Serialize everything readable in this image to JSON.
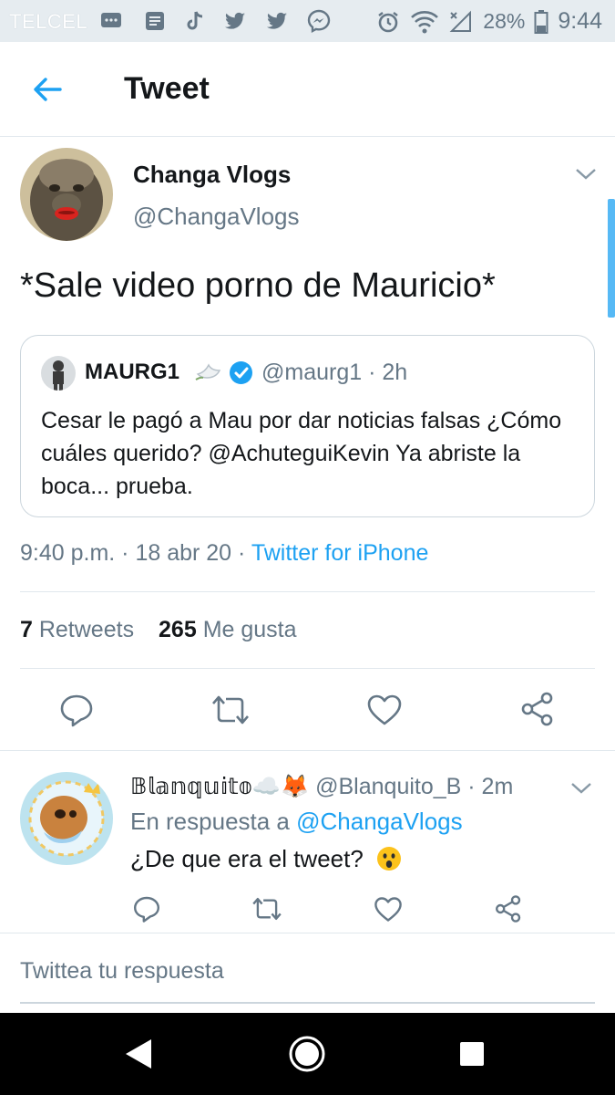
{
  "status_bar": {
    "carrier": "TELCEL",
    "battery_percent": "28%",
    "time": "9:44",
    "icons": [
      "message-icon",
      "news-icon",
      "tiktok-icon",
      "twitter-icon",
      "twitter-icon",
      "messenger-icon",
      "alarm-icon",
      "wifi-icon",
      "signal-icon",
      "battery-icon"
    ]
  },
  "header": {
    "title": "Tweet"
  },
  "tweet": {
    "author_name": "Changa Vlogs",
    "author_handle": "@ChangaVlogs",
    "text": "*Sale video porno de Mauricio*",
    "quoted": {
      "name": "MAURG1",
      "handle_time": "@maurg1 · 2h",
      "text": "Cesar le pagó a Mau por dar noticias falsas ¿Cómo cuáles querido? @AchuteguiKevin Ya abriste la boca... prueba."
    },
    "timestamp": "9:40 p.m. · 18 abr 20 · ",
    "source": "Twitter for iPhone",
    "retweets_count": "7",
    "retweets_label": " Retweets",
    "likes_count": "265",
    "likes_label": " Me gusta"
  },
  "reply": {
    "name": "𝔹𝕝𝕒𝕟𝕢𝕦𝕚𝕥𝕠",
    "name_emojis": "☁️🦊",
    "handle_time": "@Blanquito_B · 2m",
    "in_reply_prefix": "En respuesta a ",
    "in_reply_handle": "@ChangaVlogs",
    "text": "¿De que era el tweet?"
  },
  "compose": {
    "placeholder": "Twittea tu respuesta"
  },
  "colors": {
    "accent": "#1da1f2",
    "secondary_text": "#657786",
    "divider": "#e1e8ed"
  }
}
